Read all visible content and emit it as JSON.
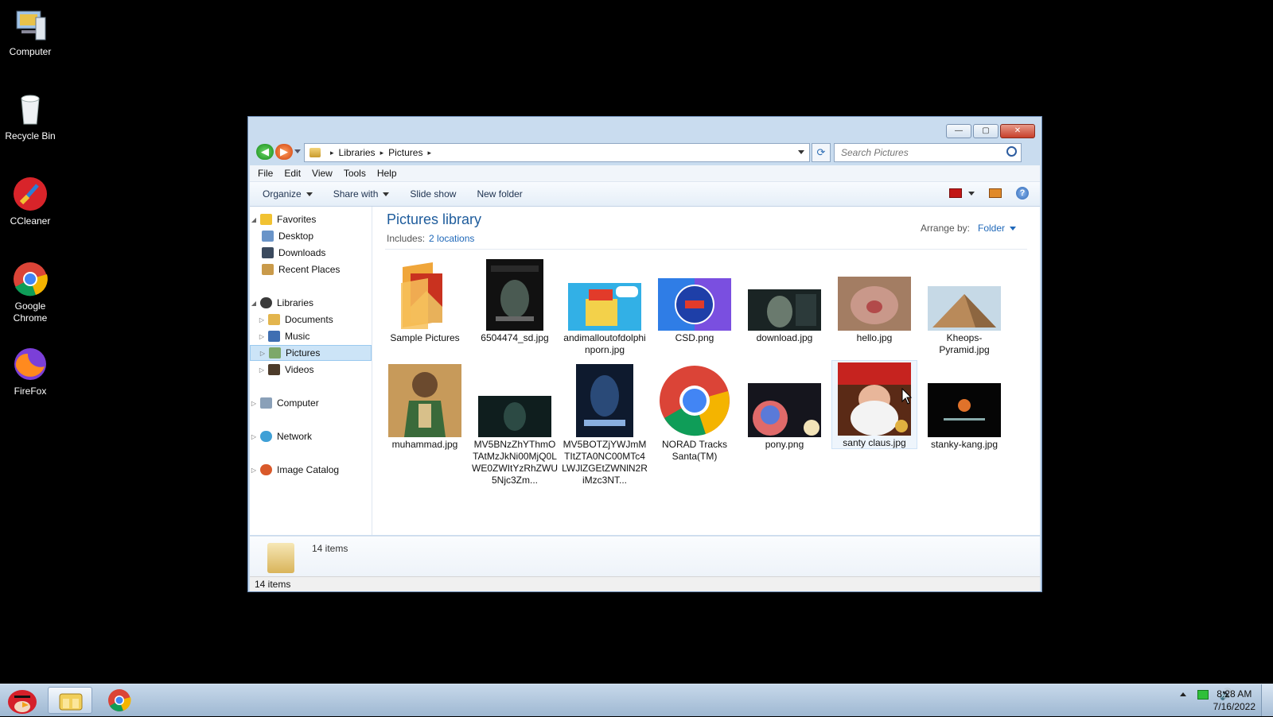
{
  "desktop": {
    "icons": [
      {
        "label": "Computer",
        "icon": "computer-icon"
      },
      {
        "label": "Recycle Bin",
        "icon": "recycle-bin-icon"
      },
      {
        "label": "CCleaner",
        "icon": "ccleaner-icon"
      },
      {
        "label": "Google Chrome",
        "icon": "chrome-icon"
      },
      {
        "label": "FireFox",
        "icon": "firefox-icon"
      }
    ]
  },
  "window": {
    "controls": {
      "minimize": "—",
      "maximize": "▢",
      "close": "✕"
    },
    "address": {
      "crumbs": [
        "Libraries",
        "Pictures"
      ],
      "separator": "▸"
    },
    "search_placeholder": "Search Pictures",
    "menu": [
      "File",
      "Edit",
      "View",
      "Tools",
      "Help"
    ],
    "commands": {
      "organize": "Organize",
      "share_with": "Share with",
      "slide_show": "Slide show",
      "new_folder": "New folder"
    },
    "help_glyph": "?",
    "nav": {
      "favorites": "Favorites",
      "desktop": "Desktop",
      "downloads": "Downloads",
      "recent_places": "Recent Places",
      "libraries": "Libraries",
      "documents": "Documents",
      "music": "Music",
      "pictures": "Pictures",
      "videos": "Videos",
      "computer": "Computer",
      "network": "Network",
      "image_catalog": "Image Catalog"
    },
    "library": {
      "title": "Pictures library",
      "includes_label": "Includes:",
      "includes_link": "2 locations",
      "arrange_label": "Arrange by:",
      "arrange_value": "Folder"
    },
    "files": [
      {
        "name": "Sample Pictures"
      },
      {
        "name": "6504474_sd.jpg"
      },
      {
        "name": "andimalloutofdolphinporn.jpg"
      },
      {
        "name": "CSD.png"
      },
      {
        "name": "download.jpg"
      },
      {
        "name": "hello.jpg"
      },
      {
        "name": "Kheops-Pyramid.jpg"
      },
      {
        "name": "muhammad.jpg"
      },
      {
        "name": "MV5BNzZhYThmOTAtMzJkNi00MjQ0LWE0ZWItYzRhZWU5Njc3Zm..."
      },
      {
        "name": "MV5BOTZjYWJmMTItZTA0NC00MTc4LWJlZGEtZWNlN2RiMzc3NT..."
      },
      {
        "name": "NORAD Tracks Santa(TM)"
      },
      {
        "name": "pony.png"
      },
      {
        "name": "santy claus.jpg"
      },
      {
        "name": "stanky-kang.jpg"
      }
    ],
    "details_text": "14 items",
    "status_text": "14 items"
  },
  "taskbar": {
    "clock_time": "8:28 AM",
    "clock_date": "7/16/2022",
    "volume_glyph": "🔊"
  },
  "colors": {
    "accent": "#1e5c9c",
    "link": "#1f68b9",
    "selection": "#cce4f7"
  }
}
